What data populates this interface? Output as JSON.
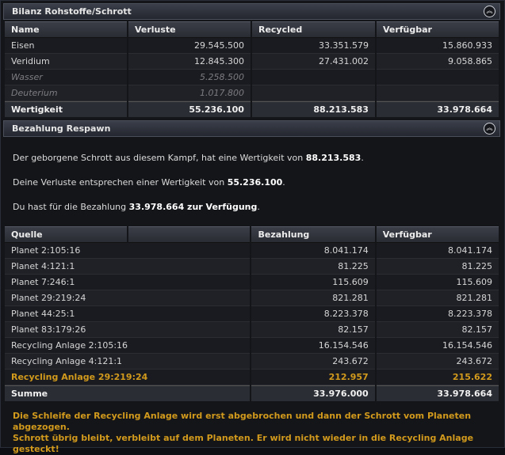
{
  "bilanz": {
    "title": "Bilanz Rohstoffe/Schrott",
    "columns": [
      "Name",
      "Verluste",
      "Recycled",
      "Verfügbar"
    ],
    "rows": [
      {
        "name": "Eisen",
        "verluste": "29.545.500",
        "recycled": "33.351.579",
        "verfuegbar": "15.860.933"
      },
      {
        "name": "Veridium",
        "verluste": "12.845.300",
        "recycled": "27.431.002",
        "verfuegbar": "9.058.865"
      },
      {
        "name": "Wasser",
        "verluste": "5.258.500",
        "recycled": "",
        "verfuegbar": ""
      },
      {
        "name": "Deuterium",
        "verluste": "1.017.800",
        "recycled": "",
        "verfuegbar": ""
      }
    ],
    "total": {
      "name": "Wertigkeit",
      "verluste": "55.236.100",
      "recycled": "88.213.583",
      "verfuegbar": "33.978.664"
    }
  },
  "bezahlung": {
    "title": "Bezahlung Respawn",
    "p1_text": "Der geborgene Schrott aus diesem Kampf, hat eine Wertigkeit von",
    "p1_value": "88.213.583",
    "p1_end": ".",
    "p2_text": "Deine Verluste entsprechen einer Wertigkeit von",
    "p2_value": "55.236.100",
    "p2_end": ".",
    "p3_text": "Du hast für die Bezahlung",
    "p3_value": "33.978.664 zur Verfügung",
    "p3_end": ".",
    "columns": [
      "Quelle",
      "",
      "Bezahlung",
      "Verfügbar"
    ],
    "rows": [
      {
        "quelle": "Planet 2:105:16",
        "bezahlung": "8.041.174",
        "verfuegbar": "8.041.174"
      },
      {
        "quelle": "Planet 4:121:1",
        "bezahlung": "81.225",
        "verfuegbar": "81.225"
      },
      {
        "quelle": "Planet 7:246:1",
        "bezahlung": "115.609",
        "verfuegbar": "115.609"
      },
      {
        "quelle": "Planet 29:219:24",
        "bezahlung": "821.281",
        "verfuegbar": "821.281"
      },
      {
        "quelle": "Planet 44:25:1",
        "bezahlung": "8.223.378",
        "verfuegbar": "8.223.378"
      },
      {
        "quelle": "Planet 83:179:26",
        "bezahlung": "82.157",
        "verfuegbar": "82.157"
      },
      {
        "quelle": "Recycling Anlage 2:105:16",
        "bezahlung": "16.154.546",
        "verfuegbar": "16.154.546"
      },
      {
        "quelle": "Recycling Anlage 4:121:1",
        "bezahlung": "243.672",
        "verfuegbar": "243.672"
      },
      {
        "quelle": "Recycling Anlage 29:219:24",
        "bezahlung": "212.957",
        "verfuegbar": "215.622"
      }
    ],
    "total": {
      "quelle": "Summe",
      "bezahlung": "33.976.000",
      "verfuegbar": "33.978.664"
    },
    "warning_line1": "Die Schleife der Recycling Anlage wird erst abgebrochen und dann der Schrott vom Planeten abgezogen.",
    "warning_line2": "Schrott übrig bleibt, verbleibt auf dem Planeten. Er wird nicht wieder in die Recycling Anlage gesteckt!"
  },
  "icons": {
    "collapse": "chevron-double-up-icon"
  },
  "colors": {
    "accent": "#d29a1c"
  }
}
